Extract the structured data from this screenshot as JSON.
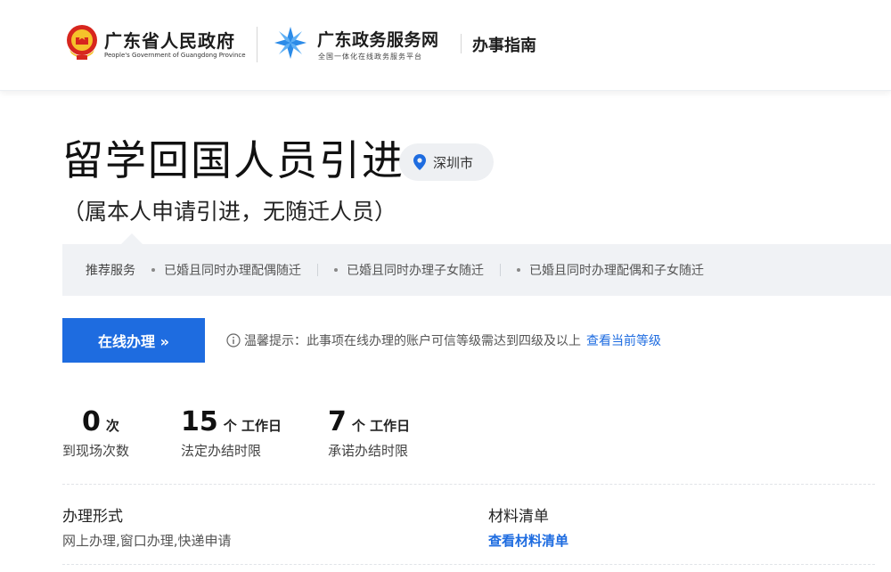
{
  "header": {
    "gov_name": "广东省人民政府",
    "gov_name_en": "People's Government of Guangdong Province",
    "service_name": "广东政务服务网",
    "service_sub": "全国一体化在线政务服务平台",
    "guide_label": "办事指南"
  },
  "item": {
    "title": "留学回国人员引进",
    "city": "深圳市",
    "subtitle": "（属本人申请引进，无随迁人员）"
  },
  "recommend": {
    "label": "推荐服务",
    "items": [
      "已婚且同时办理配偶随迁",
      "已婚且同时办理子女随迁",
      "已婚且同时办理配偶和子女随迁"
    ]
  },
  "action": {
    "apply_label": "在线办理 »",
    "notice": "温馨提示：此事项在线办理的账户可信等级需达到四级及以上",
    "notice_link": "查看当前等级"
  },
  "stats": [
    {
      "value": "0",
      "unit": "次",
      "label": "到现场次数"
    },
    {
      "value": "15",
      "unit": "个 工作日",
      "label": "法定办结时限"
    },
    {
      "value": "7",
      "unit": "个 工作日",
      "label": "承诺办结时限"
    }
  ],
  "details": {
    "form_heading": "办理形式",
    "form_value": "网上办理,窗口办理,快递申请",
    "materials_heading": "材料清单",
    "materials_link": "查看材料清单"
  },
  "colors": {
    "primary": "#1e6ce0",
    "tag_bg": "#eef0f3",
    "bar_bg": "#f0f2f5"
  },
  "icons": [
    "national-emblem-icon",
    "service-logo-icon",
    "location-pin-icon",
    "info-icon"
  ]
}
